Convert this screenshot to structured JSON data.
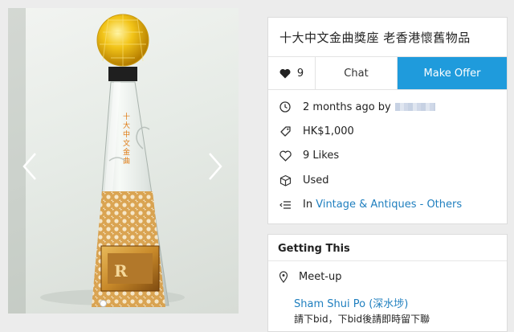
{
  "listing": {
    "title": "十大中文金曲獎座  老香港懷舊物品",
    "like_count": "9",
    "chat_label": "Chat",
    "offer_label": "Make Offer",
    "posted": "2 months ago by",
    "price": "HK$1,000",
    "likes": "9 Likes",
    "condition": "Used",
    "category_prefix": "In",
    "category": "Vintage & Antiques - Others"
  },
  "photo": {
    "trophy_text": "十大中文金曲"
  },
  "getting": {
    "title": "Getting This",
    "method": "Meet-up",
    "location": "Sham Shui Po (深水埗)",
    "note": "請下bid，下bid後請即時留下聯"
  },
  "colors": {
    "accent": "#1f9bdc",
    "link": "#1f7fbf",
    "background": "#ececec"
  },
  "icons": [
    "chevron-left-icon",
    "chevron-right-icon",
    "heart-icon",
    "clock-icon",
    "price-tag-icon",
    "heart-outline-icon",
    "box-icon",
    "list-icon",
    "location-pin-icon"
  ]
}
